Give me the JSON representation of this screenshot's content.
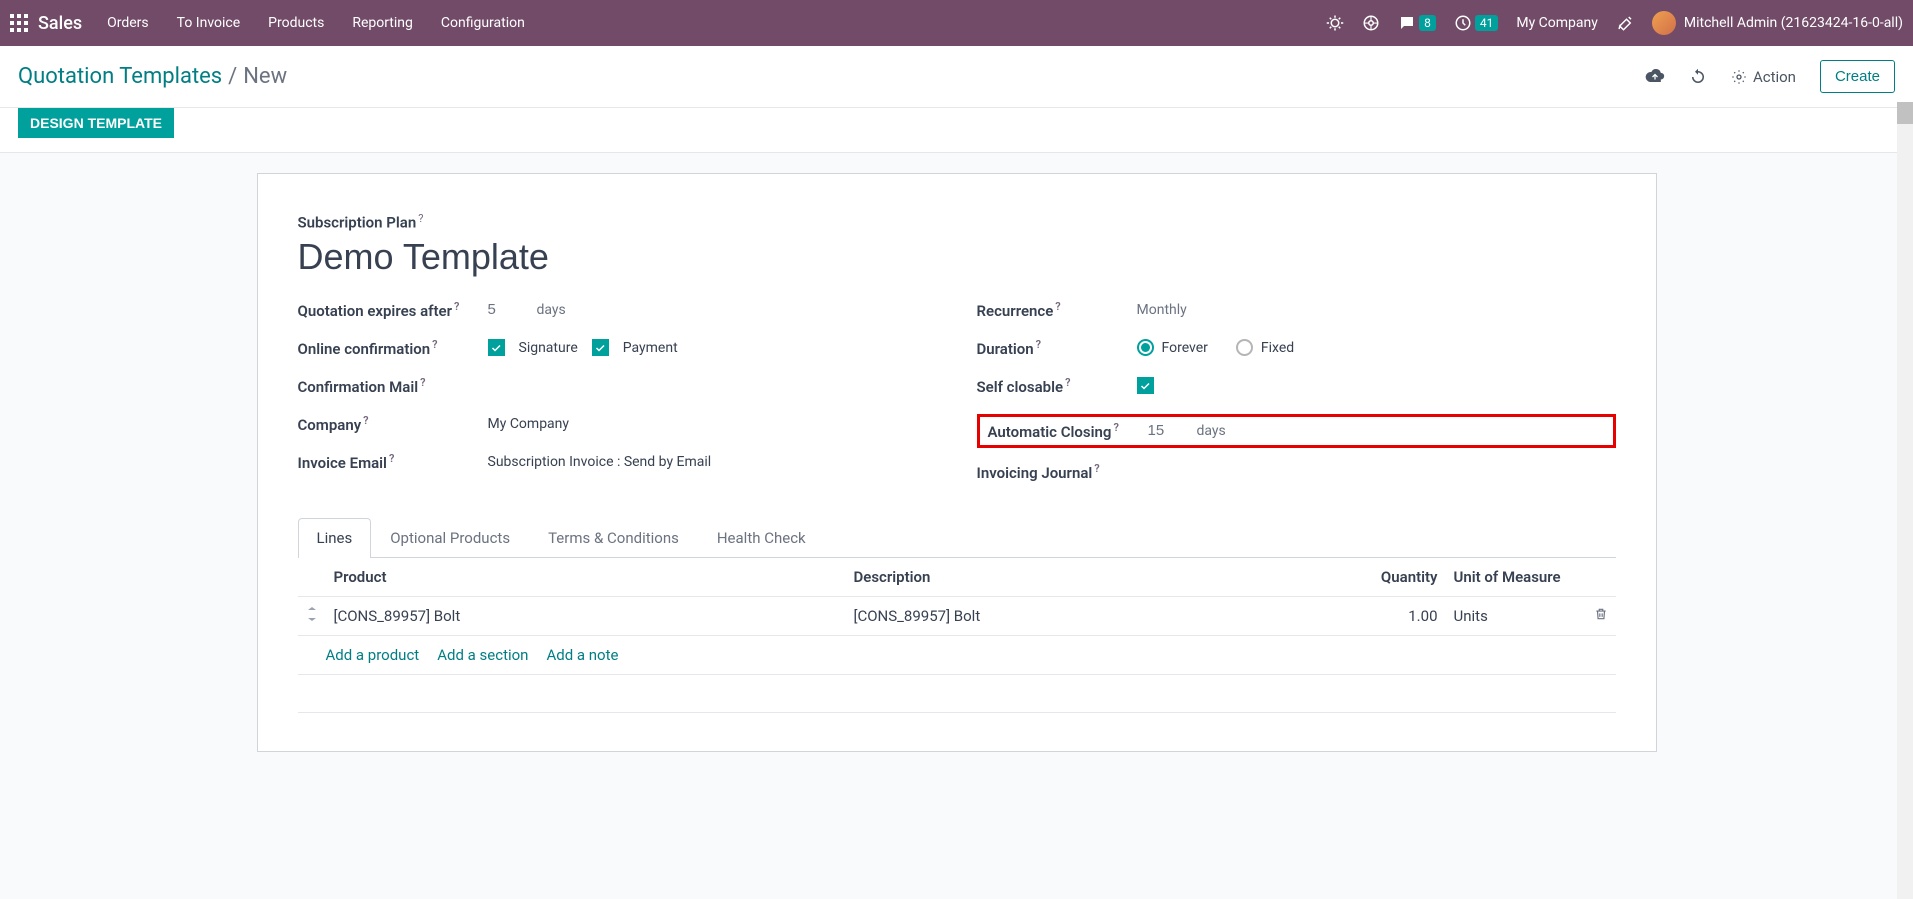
{
  "topnav": {
    "brand": "Sales",
    "menu": [
      "Orders",
      "To Invoice",
      "Products",
      "Reporting",
      "Configuration"
    ],
    "msg_badge": "8",
    "clock_badge": "41",
    "company": "My Company",
    "user": "Mitchell Admin (21623424-16-0-all)"
  },
  "breadcrumb": {
    "root": "Quotation Templates",
    "current": "New",
    "action_label": "Action",
    "create_label": "Create"
  },
  "status": {
    "design_btn": "DESIGN TEMPLATE"
  },
  "form": {
    "sub_plan_label": "Subscription Plan",
    "title": "Demo Template",
    "left": {
      "expires_label": "Quotation expires after",
      "expires_value": "5",
      "expires_unit": "days",
      "online_conf_label": "Online confirmation",
      "signature_label": "Signature",
      "payment_label": "Payment",
      "conf_mail_label": "Confirmation Mail",
      "company_label": "Company",
      "company_value": "My Company",
      "invoice_email_label": "Invoice Email",
      "invoice_email_value": "Subscription Invoice : Send by Email"
    },
    "right": {
      "recurrence_label": "Recurrence",
      "recurrence_value": "Monthly",
      "duration_label": "Duration",
      "forever_label": "Forever",
      "fixed_label": "Fixed",
      "self_closable_label": "Self closable",
      "auto_closing_label": "Automatic Closing",
      "auto_closing_value": "15",
      "auto_closing_unit": "days",
      "invoicing_journal_label": "Invoicing Journal"
    }
  },
  "tabs": [
    "Lines",
    "Optional Products",
    "Terms & Conditions",
    "Health Check"
  ],
  "table": {
    "headers": {
      "product": "Product",
      "description": "Description",
      "quantity": "Quantity",
      "uom": "Unit of Measure"
    },
    "rows": [
      {
        "product": "[CONS_89957] Bolt",
        "description": "[CONS_89957] Bolt",
        "quantity": "1.00",
        "uom": "Units"
      }
    ],
    "add_product": "Add a product",
    "add_section": "Add a section",
    "add_note": "Add a note"
  }
}
